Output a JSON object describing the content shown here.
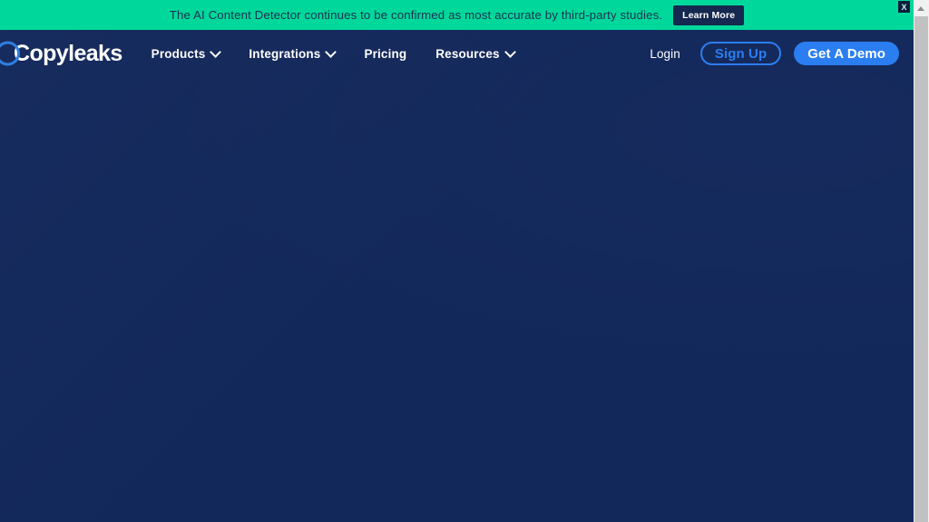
{
  "banner": {
    "message": "The AI Content Detector continues to be confirmed as most accurate by third-party studies.",
    "cta_label": "Learn More",
    "close_label": "X",
    "background_color": "#00d89b",
    "text_color": "#1a3350",
    "cta_background_color": "#15284f"
  },
  "header": {
    "logo_text": "Copyleaks",
    "logo_ring_color": "#2f7fe0",
    "background_color": "#12275a",
    "nav_items": [
      {
        "label": "Products",
        "has_dropdown": true
      },
      {
        "label": "Integrations",
        "has_dropdown": true
      },
      {
        "label": "Pricing",
        "has_dropdown": false
      },
      {
        "label": "Resources",
        "has_dropdown": true
      }
    ],
    "actions": {
      "login_label": "Login",
      "signup_label": "Sign Up",
      "demo_label": "Get A Demo",
      "accent_color": "#2b7ef0"
    }
  },
  "main": {
    "background_color": "#13285c"
  },
  "scrollbar": {
    "track_color": "#f1f1f1",
    "thumb_color": "#c1c1c1"
  }
}
